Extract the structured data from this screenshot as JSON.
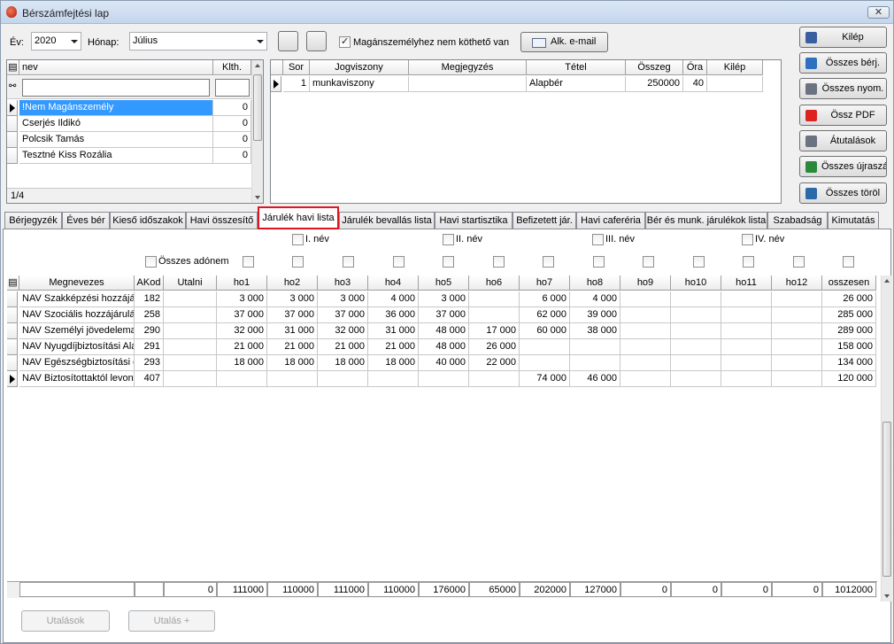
{
  "window": {
    "title": "Bérszámfejtési lap",
    "close_label": "✕"
  },
  "filters": {
    "ev_label": "Év:",
    "ev_value": "2020",
    "honap_label": "Hónap:",
    "honap_value": "Július",
    "mag_checkbox_label": "Magánszemélyhez nem köthető van",
    "mag_checked": true,
    "email_button": "Alk. e-mail"
  },
  "side_buttons": [
    {
      "label": "Kilép",
      "icon": "door-icon"
    },
    {
      "label": "Összes bérj.",
      "icon": "sheet-icon"
    },
    {
      "label": "Összes nyom.",
      "icon": "printer-icon"
    },
    {
      "label": "Össz PDF",
      "icon": "pdf-icon"
    },
    {
      "label": "Átutalások",
      "icon": "printer-icon"
    },
    {
      "label": "Összes újraszá.",
      "icon": "recalc-icon"
    },
    {
      "label": "Összes töröl",
      "icon": "delete-icon"
    }
  ],
  "persons": {
    "headers": {
      "nev": "nev",
      "klth": "Klth."
    },
    "rows": [
      {
        "nev": "!Nem Magánszemély",
        "klth": "0"
      },
      {
        "nev": "Cserjés Ildikó",
        "klth": "0"
      },
      {
        "nev": "Polcsik Tamás",
        "klth": "0"
      },
      {
        "nev": "Tesztné Kiss Rozália",
        "klth": "0"
      }
    ],
    "counter": "1/4"
  },
  "contracts": {
    "headers": [
      "Sor",
      "Jogviszony",
      "Megjegyzés",
      "Tétel",
      "Összeg",
      "Óra",
      "Kilép"
    ],
    "rows": [
      [
        "1",
        "munkaviszony",
        "",
        "Alapbér",
        "250000",
        "40",
        ""
      ]
    ]
  },
  "tabs": [
    "Bérjegyzék",
    "Éves bér",
    "Kieső időszakok",
    "Havi összesítő",
    "Járulék havi lista",
    "Járulék bevallás lista",
    "Havi startisztika",
    "Befizetett jár.",
    "Havi caferéria",
    "Bér és munk. járulékok lista",
    "Szabadság",
    "Kimutatás"
  ],
  "active_tab": "Járulék havi lista",
  "nev_checks": [
    "I. név",
    "II. név",
    "III. név",
    "IV. név"
  ],
  "osszes_adonem": "Összes adónem",
  "main": {
    "headers": [
      "Megnevezes",
      "AKod",
      "Utalni",
      "ho1",
      "ho2",
      "ho3",
      "ho4",
      "ho5",
      "ho6",
      "ho7",
      "ho8",
      "ho9",
      "ho10",
      "ho11",
      "ho12",
      "osszesen"
    ],
    "rows": [
      [
        "NAV Szakképzési hozzájár",
        "182",
        "",
        "3 000",
        "3 000",
        "3 000",
        "4 000",
        "3 000",
        "",
        "6 000",
        "4 000",
        "",
        "",
        "",
        "",
        "26 000"
      ],
      [
        "NAV Szociális hozzájárulás",
        "258",
        "",
        "37 000",
        "37 000",
        "37 000",
        "36 000",
        "37 000",
        "",
        "62 000",
        "39 000",
        "",
        "",
        "",
        "",
        "285 000"
      ],
      [
        "NAV Személyi jövedelemad",
        "290",
        "",
        "32 000",
        "31 000",
        "32 000",
        "31 000",
        "48 000",
        "17 000",
        "60 000",
        "38 000",
        "",
        "",
        "",
        "",
        "289 000"
      ],
      [
        "NAV Nyugdíjbiztosítási Ala",
        "291",
        "",
        "21 000",
        "21 000",
        "21 000",
        "21 000",
        "48 000",
        "26 000",
        "",
        "",
        "",
        "",
        "",
        "",
        "158 000"
      ],
      [
        "NAV Egészségbiztosítási é",
        "293",
        "",
        "18 000",
        "18 000",
        "18 000",
        "18 000",
        "40 000",
        "22 000",
        "",
        "",
        "",
        "",
        "",
        "",
        "134 000"
      ],
      [
        "NAV Biztosítottaktól levont",
        "407",
        "",
        "",
        "",
        "",
        "",
        "",
        "",
        "74 000",
        "46 000",
        "",
        "",
        "",
        "",
        "120 000"
      ]
    ],
    "totals": [
      "",
      "",
      "0",
      "111000",
      "110000",
      "111000",
      "110000",
      "176000",
      "65000",
      "202000",
      "127000",
      "0",
      "0",
      "0",
      "0",
      "1012000"
    ]
  },
  "bottom_buttons": [
    "Utalások",
    "Utalás +"
  ]
}
